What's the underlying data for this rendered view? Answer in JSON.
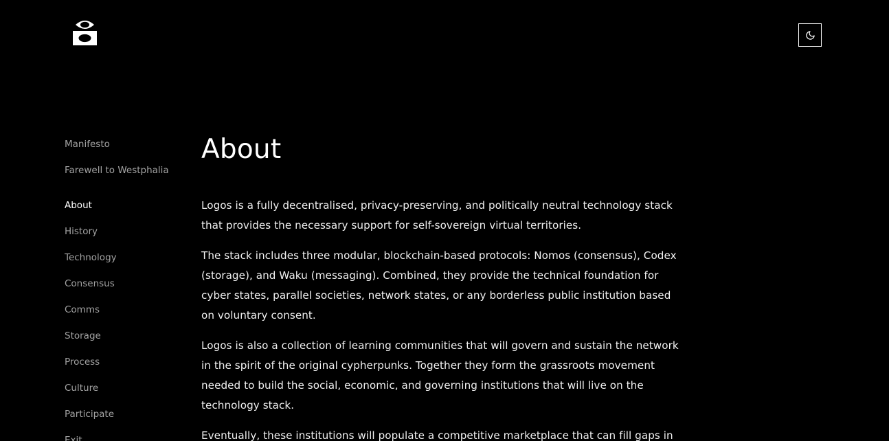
{
  "brand": {
    "logo_icon": "logos-eye-icon"
  },
  "header": {
    "theme_toggle_icon": "moon-icon"
  },
  "sidebar": {
    "top_items": [
      {
        "label": "Manifesto"
      },
      {
        "label": "Farewell to Westphalia"
      }
    ],
    "items": [
      {
        "label": "About",
        "active": true
      },
      {
        "label": "History"
      },
      {
        "label": "Technology"
      },
      {
        "label": "Consensus"
      },
      {
        "label": "Comms"
      },
      {
        "label": "Storage"
      },
      {
        "label": "Process"
      },
      {
        "label": "Culture"
      },
      {
        "label": "Participate"
      },
      {
        "label": "Exit"
      }
    ]
  },
  "main": {
    "title": "About",
    "paragraphs": [
      "Logos is a fully decentralised, privacy-preserving, and politically neutral technology stack that provides the necessary support for self-sovereign virtual territories.",
      "The stack includes three modular, blockchain-based protocols: Nomos (consensus), Codex (storage), and Waku (messaging). Combined, they provide the technical foundation for cyber states, parallel societies, network states, or any borderless public institution based on voluntary consent.",
      "Logos is also a collection of learning communities that will govern and sustain the network in the spirit of the original cypherpunks. Together they form the grassroots movement needed to build the social, economic, and governing institutions that will live on the technology stack.",
      "Eventually, these institutions will populate a competitive marketplace that can fill gaps in"
    ]
  },
  "colors": {
    "background": "#000000",
    "text": "#ffffff",
    "muted_nav": "#a3a3a3"
  }
}
